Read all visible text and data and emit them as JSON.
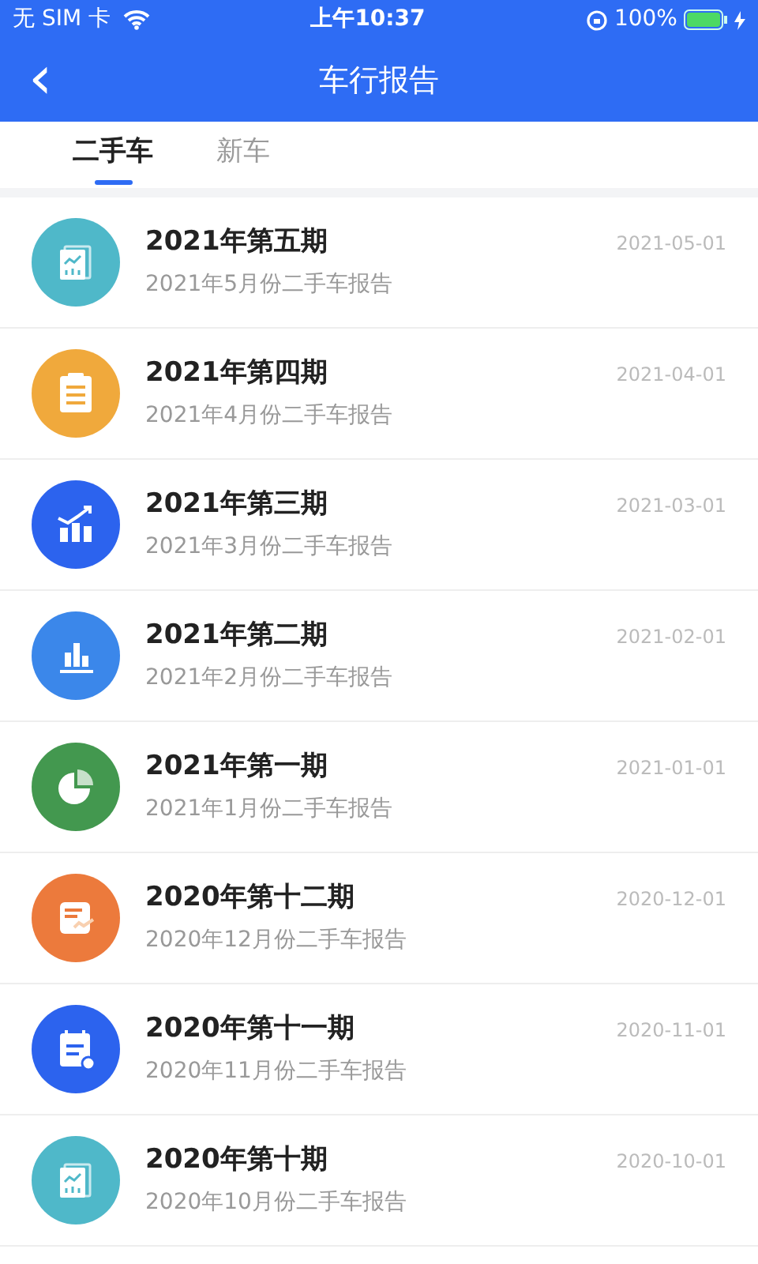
{
  "status_bar": {
    "carrier": "无 SIM 卡",
    "time": "上午10:37",
    "battery": "100%"
  },
  "header": {
    "back": "‹",
    "title": "车行报告"
  },
  "tabs": [
    {
      "label": "二手车",
      "selected": true
    },
    {
      "label": "新车",
      "selected": false
    }
  ],
  "reports": [
    {
      "title": "2021年第五期",
      "subtitle": "2021年5月份二手车报告",
      "date": "2021-05-01",
      "kind": "doc",
      "color": "#4fb8c9"
    },
    {
      "title": "2021年第四期",
      "subtitle": "2021年4月份二手车报告",
      "date": "2021-04-01",
      "kind": "clipboard",
      "color": "#f0a93c"
    },
    {
      "title": "2021年第三期",
      "subtitle": "2021年3月份二手车报告",
      "date": "2021-03-01",
      "kind": "trend",
      "color": "#2c63ee"
    },
    {
      "title": "2021年第二期",
      "subtitle": "2021年2月份二手车报告",
      "date": "2021-02-01",
      "kind": "bars",
      "color": "#3b87ea"
    },
    {
      "title": "2021年第一期",
      "subtitle": "2021年1月份二手车报告",
      "date": "2021-01-01",
      "kind": "pie",
      "color": "#43984f"
    },
    {
      "title": "2020年第十二期",
      "subtitle": "2020年12月份二手车报告",
      "date": "2020-12-01",
      "kind": "report",
      "color": "#ec7a3c"
    },
    {
      "title": "2020年第十一期",
      "subtitle": "2020年11月份二手车报告",
      "date": "2020-11-01",
      "kind": "calendar",
      "color": "#2c63ee"
    },
    {
      "title": "2020年第十期",
      "subtitle": "2020年10月份二手车报告",
      "date": "2020-10-01",
      "kind": "doc",
      "color": "#4fb8c9"
    }
  ]
}
